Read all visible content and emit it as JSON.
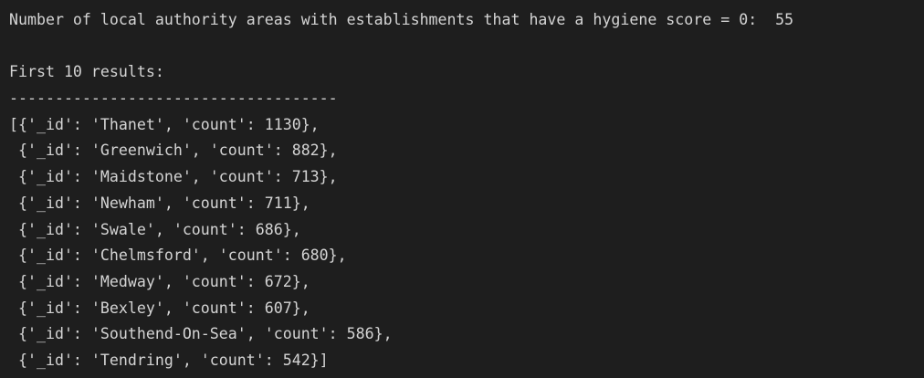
{
  "output": {
    "summary_line": "Number of local authority areas with establishments that have a hygiene score = 0:  55",
    "results_header": "First 10 results:",
    "separator": "------------------------------------",
    "results": [
      "[{'_id': 'Thanet', 'count': 1130},",
      " {'_id': 'Greenwich', 'count': 882},",
      " {'_id': 'Maidstone', 'count': 713},",
      " {'_id': 'Newham', 'count': 711},",
      " {'_id': 'Swale', 'count': 686},",
      " {'_id': 'Chelmsford', 'count': 680},",
      " {'_id': 'Medway', 'count': 672},",
      " {'_id': 'Bexley', 'count': 607},",
      " {'_id': 'Southend-On-Sea', 'count': 586},",
      " {'_id': 'Tendring', 'count': 542}]"
    ]
  }
}
